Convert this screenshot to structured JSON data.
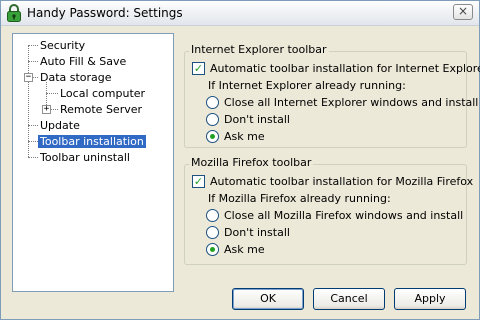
{
  "window": {
    "title": "Handy Password: Settings",
    "close_glyph": "×"
  },
  "tree": {
    "items": [
      {
        "label": "Security"
      },
      {
        "label": "Auto Fill & Save"
      },
      {
        "label": "Data storage",
        "expander": "−"
      },
      {
        "label": "Local computer"
      },
      {
        "label": "Remote Server",
        "expander": "+"
      },
      {
        "label": "Update"
      },
      {
        "label": "Toolbar installation",
        "selected": true
      },
      {
        "label": "Toolbar uninstall"
      }
    ]
  },
  "ie_group": {
    "title": "Internet Explorer toolbar",
    "auto_install_label": "Automatic toolbar installation for Internet Explorer",
    "auto_install_checked": true,
    "running_label": "If Internet Explorer already running:",
    "options": [
      {
        "label": "Close all Internet Explorer windows and install",
        "selected": false
      },
      {
        "label": "Don't install",
        "selected": false
      },
      {
        "label": "Ask me",
        "selected": true
      }
    ]
  },
  "ff_group": {
    "title": "Mozilla Firefox toolbar",
    "auto_install_label": "Automatic toolbar installation for Mozilla Firefox",
    "auto_install_checked": true,
    "running_label": "If Mozilla Firefox already running:",
    "options": [
      {
        "label": "Close all Mozilla Firefox windows and install",
        "selected": false
      },
      {
        "label": "Don't install",
        "selected": false
      },
      {
        "label": "Ask me",
        "selected": true
      }
    ]
  },
  "buttons": {
    "ok": "OK",
    "cancel": "Cancel",
    "apply": "Apply"
  },
  "colors": {
    "selection": "#316ac5",
    "check": "#21a121",
    "app_icon": "#2e8b2e"
  },
  "icons": {
    "app": "lock-icon"
  }
}
